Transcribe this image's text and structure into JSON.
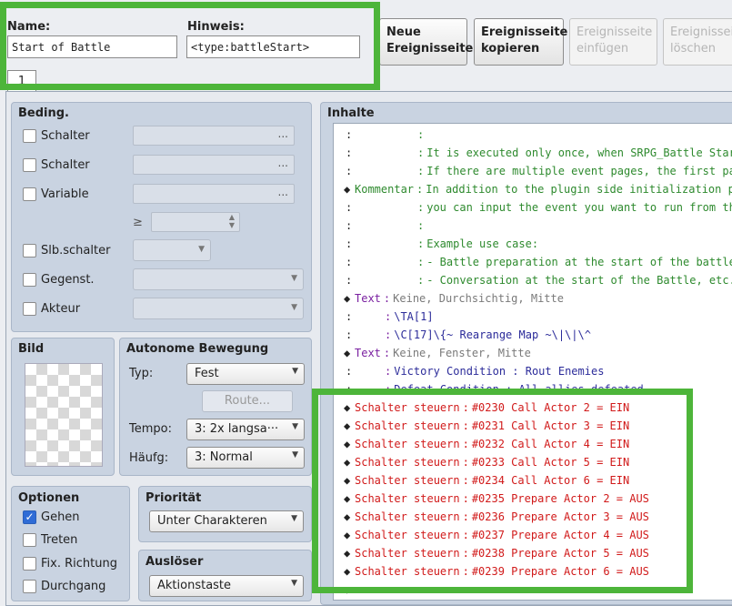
{
  "header": {
    "name_label": "Name:",
    "name_value": "Start of Battle",
    "hint_label": "Hinweis:",
    "hint_value": "<type:battleStart>",
    "page_tab": "1"
  },
  "toolbar": {
    "new_page": "Neue Ereignisseite",
    "copy_page": "Ereignisseite kopieren",
    "paste_page": "Ereignisseite einfügen",
    "delete_page": "Ereignisseite löschen"
  },
  "conditions": {
    "title": "Beding.",
    "switch1": "Schalter",
    "switch2": "Schalter",
    "variable": "Variable",
    "ge_symbol": "≥",
    "self_switch": "Slb.schalter",
    "item": "Gegenst.",
    "actor": "Akteur",
    "ellipsis": "..."
  },
  "image": {
    "title": "Bild"
  },
  "autonomous": {
    "title": "Autonome Bewegung",
    "type_label": "Typ:",
    "type_value": "Fest",
    "route_button": "Route...",
    "speed_label": "Tempo:",
    "speed_value": "3: 2x langsa···",
    "freq_label": "Häufg:",
    "freq_value": "3: Normal"
  },
  "options": {
    "title": "Optionen",
    "walking": "Gehen",
    "walking_checked": true,
    "stepping": "Treten",
    "direction_fix": "Fix. Richtung",
    "through": "Durchgang"
  },
  "priority": {
    "title": "Priorität",
    "value": "Unter Charakteren"
  },
  "trigger": {
    "title": "Auslöser",
    "value": "Aktionstaste"
  },
  "contents": {
    "title": "Inhalte",
    "colors": {
      "comment": "#2e8a2e",
      "text": "#7a1fa0",
      "switch": "#d11a1a",
      "gray": "#7a7a7a",
      "blue": "#2c2c9a"
    },
    "rows": [
      {
        "p": ":",
        "t": "",
        "s": ":",
        "c": "",
        "color": "comment"
      },
      {
        "p": ":",
        "t": "",
        "s": ":",
        "c": "It is executed only once, when SRPG_Battle Start b",
        "color": "comment"
      },
      {
        "p": ":",
        "t": "",
        "s": ":",
        "c": "If there are multiple event pages, the first page",
        "color": "comment"
      },
      {
        "p": "◆",
        "t": "Kommentar",
        "s": ":",
        "c": "In addition to the plugin side initialization proc",
        "color": "comment"
      },
      {
        "p": ":",
        "t": "",
        "s": ":",
        "c": "you can input the event you want to run from the s",
        "color": "comment"
      },
      {
        "p": ":",
        "t": "",
        "s": ":",
        "c": "",
        "color": "comment"
      },
      {
        "p": ":",
        "t": "",
        "s": ":",
        "c": "Example use case:",
        "color": "comment"
      },
      {
        "p": ":",
        "t": "",
        "s": ":",
        "c": "- Battle preparation at the start of the battle",
        "color": "comment"
      },
      {
        "p": ":",
        "t": "",
        "s": ":",
        "c": "- Conversation at the start of the Battle, etc.",
        "color": "comment"
      },
      {
        "p": "◆",
        "t": "Text",
        "s": ":",
        "c": "Keine, Durchsichtig, Mitte",
        "color": "text"
      },
      {
        "p": ":",
        "t": "",
        "s": ":",
        "c": "\\TA[1]",
        "color": "text"
      },
      {
        "p": ":",
        "t": "",
        "s": ":",
        "c": "\\C[17]\\{~ Rearange Map ~\\|\\|\\^",
        "color": "text"
      },
      {
        "p": "◆",
        "t": "Text",
        "s": ":",
        "c": "Keine, Fenster, Mitte",
        "color": "text"
      },
      {
        "p": ":",
        "t": "",
        "s": ":",
        "c": "Victory Condition : Rout Enemies",
        "color": "text"
      },
      {
        "p": ":",
        "t": "",
        "s": ":",
        "c": "Defeat Condition : All allies defeated",
        "color": "text"
      },
      {
        "p": "◆",
        "t": "Schalter steuern",
        "s": ":",
        "c": "#0230 Call Actor 2 = EIN",
        "color": "switch"
      },
      {
        "p": "◆",
        "t": "Schalter steuern",
        "s": ":",
        "c": "#0231 Call Actor 3 = EIN",
        "color": "switch"
      },
      {
        "p": "◆",
        "t": "Schalter steuern",
        "s": ":",
        "c": "#0232 Call Actor 4 = EIN",
        "color": "switch"
      },
      {
        "p": "◆",
        "t": "Schalter steuern",
        "s": ":",
        "c": "#0233 Call Actor 5 = EIN",
        "color": "switch"
      },
      {
        "p": "◆",
        "t": "Schalter steuern",
        "s": ":",
        "c": "#0234 Call Actor 6 = EIN",
        "color": "switch"
      },
      {
        "p": "◆",
        "t": "Schalter steuern",
        "s": ":",
        "c": "#0235 Prepare Actor 2 = AUS",
        "color": "switch"
      },
      {
        "p": "◆",
        "t": "Schalter steuern",
        "s": ":",
        "c": "#0236 Prepare Actor 3 = AUS",
        "color": "switch"
      },
      {
        "p": "◆",
        "t": "Schalter steuern",
        "s": ":",
        "c": "#0237 Prepare Actor 4 = AUS",
        "color": "switch"
      },
      {
        "p": "◆",
        "t": "Schalter steuern",
        "s": ":",
        "c": "#0238 Prepare Actor 5 = AUS",
        "color": "switch"
      },
      {
        "p": "◆",
        "t": "Schalter steuern",
        "s": ":",
        "c": "#0239 Prepare Actor 6 = AUS",
        "color": "switch"
      },
      {
        "p": "◆",
        "t": "",
        "s": "",
        "c": "",
        "color": "switch"
      }
    ]
  }
}
